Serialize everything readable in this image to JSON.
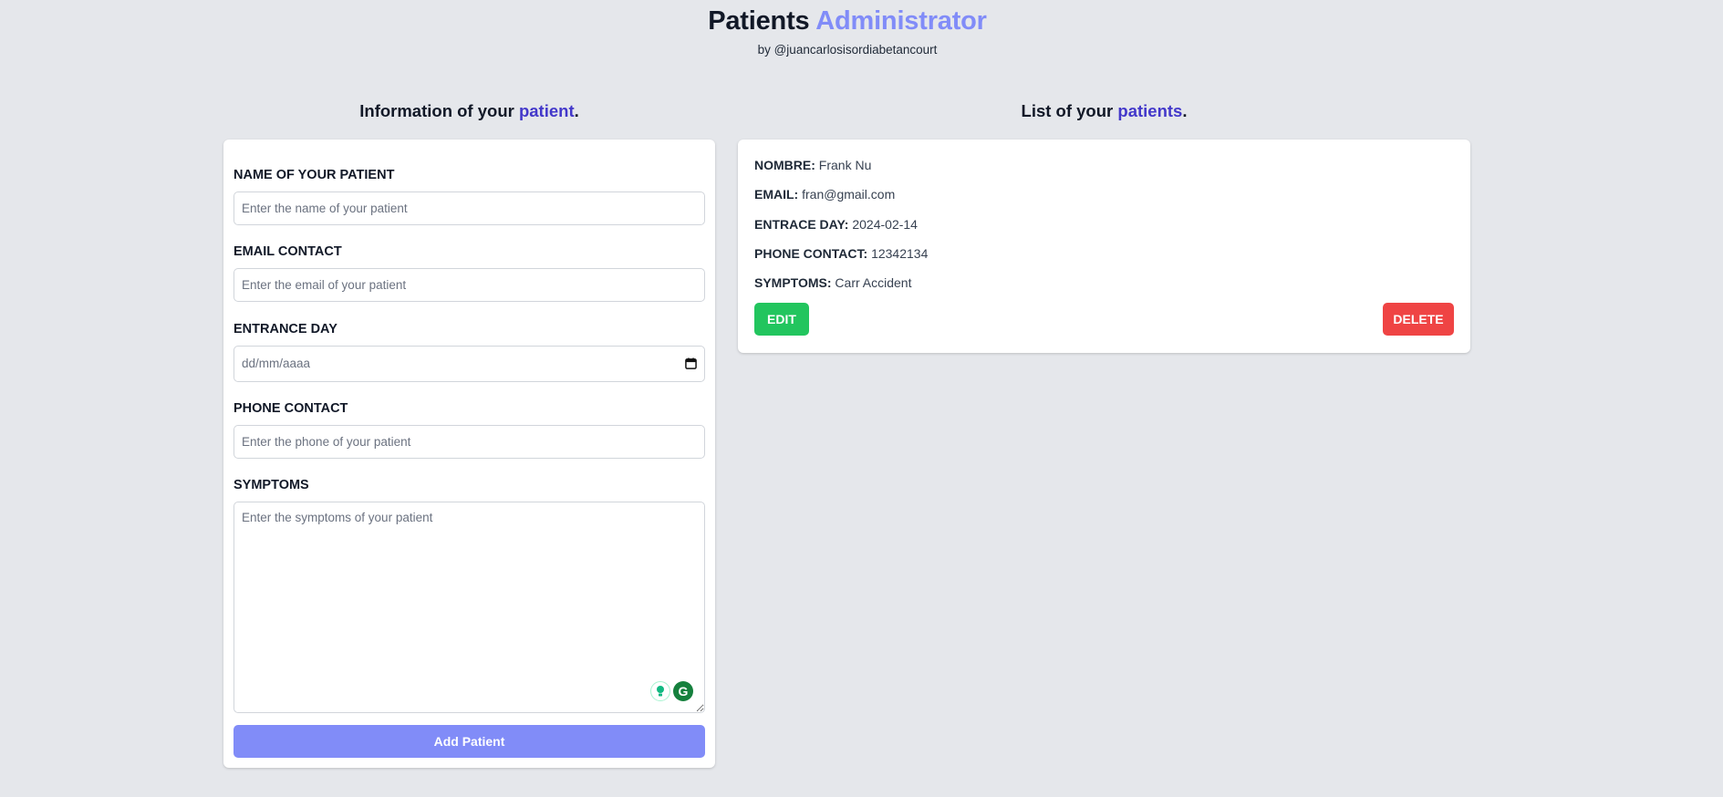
{
  "header": {
    "title_main": "Patients",
    "title_accent": "Administrator",
    "byline": "by @juancarlosisordiabetancourt"
  },
  "form_section": {
    "heading_prefix": "Information of your",
    "heading_accent": "patient",
    "heading_suffix": "."
  },
  "list_section": {
    "heading_prefix": "List of your",
    "heading_accent": "patients",
    "heading_suffix": "."
  },
  "form": {
    "name_label": "NAME OF YOUR PATIENT",
    "name_placeholder": "Enter the name of your patient",
    "name_value": "",
    "email_label": "EMAIL CONTACT",
    "email_placeholder": "Enter the email of your patient",
    "email_value": "",
    "date_label": "ENTRANCE DAY",
    "date_placeholder": "dd/mm/aaaa",
    "phone_label": "PHONE CONTACT",
    "phone_placeholder": "Enter the phone of your patient",
    "phone_value": "",
    "symptoms_label": "SYMPTOMS",
    "symptoms_placeholder": "Enter the symptoms of your patient",
    "symptoms_value": "",
    "submit_label": "Add Patient"
  },
  "patients": [
    {
      "name_key": "NOMBRE:",
      "name": "Frank Nu",
      "email_key": "EMAIL:",
      "email": "fran@gmail.com",
      "date_key": "ENTRACE DAY:",
      "date": "2024-02-14",
      "phone_key": "PHONE CONTACT:",
      "phone": "12342134",
      "symptoms_key": "SYMPTOMS:",
      "symptoms": "Carr Accident",
      "edit_label": "EDIT",
      "delete_label": "DELETE"
    }
  ],
  "colors": {
    "background": "#e5e7eb",
    "accent": "#818cf8",
    "heading_accent": "#4338ca",
    "edit": "#22c55e",
    "delete": "#ef4444"
  },
  "icons": {
    "date_picker": "calendar-icon",
    "extension_1": "lightbulb-icon",
    "extension_2": "grammarly-icon"
  }
}
